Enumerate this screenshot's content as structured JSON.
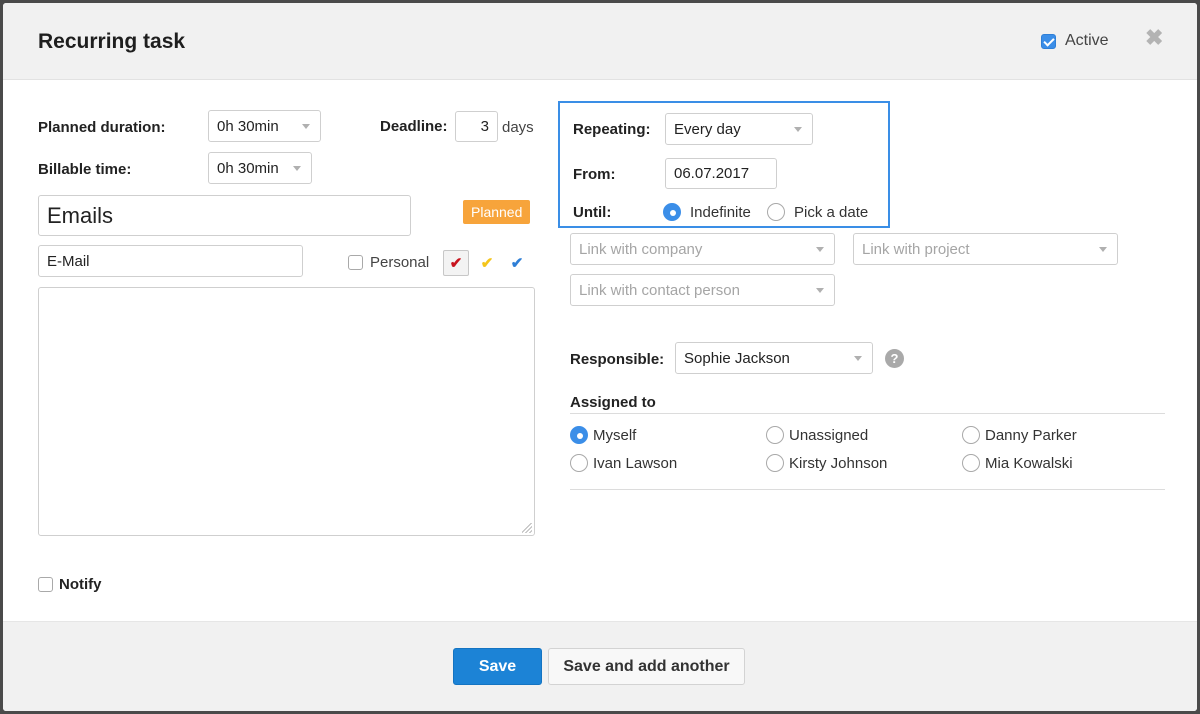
{
  "dialog": {
    "title": "Recurring task",
    "active_label": "Active",
    "active_checked": true,
    "close_glyph": "✖"
  },
  "left": {
    "planned_duration_label": "Planned duration:",
    "planned_duration_value": "0h 30min",
    "billable_time_label": "Billable time:",
    "billable_time_value": "0h 30min",
    "deadline_label": "Deadline:",
    "deadline_value": "3",
    "deadline_unit": "days",
    "title_value": "Emails",
    "status_badge": "Planned",
    "type_value": "E-Mail",
    "personal_label": "Personal",
    "description_value": "",
    "notify_label": "Notify"
  },
  "priority_colors": {
    "red": "#c8141e",
    "yellow": "#f4c51b",
    "blue": "#2f7fd6"
  },
  "repeating": {
    "repeating_label": "Repeating:",
    "repeating_value": "Every day",
    "from_label": "From:",
    "from_value": "06.07.2017",
    "until_label": "Until:",
    "until_options": [
      {
        "label": "Indefinite",
        "checked": true
      },
      {
        "label": "Pick a date",
        "checked": false
      }
    ]
  },
  "links": {
    "company_placeholder": "Link with company",
    "project_placeholder": "Link with project",
    "contact_placeholder": "Link with contact person"
  },
  "responsible": {
    "label": "Responsible:",
    "value": "Sophie Jackson",
    "help_glyph": "?"
  },
  "assigned": {
    "heading": "Assigned to",
    "options": [
      {
        "label": "Myself",
        "checked": true
      },
      {
        "label": "Unassigned",
        "checked": false
      },
      {
        "label": "Danny Parker",
        "checked": false
      },
      {
        "label": "Ivan Lawson",
        "checked": false
      },
      {
        "label": "Kirsty Johnson",
        "checked": false
      },
      {
        "label": "Mia Kowalski",
        "checked": false
      }
    ]
  },
  "footer": {
    "save_label": "Save",
    "save_another_label": "Save and add another"
  },
  "colors": {
    "accent": "#1c83d6",
    "highlight_border": "#3a8ee6",
    "badge": "#f7a43b"
  }
}
